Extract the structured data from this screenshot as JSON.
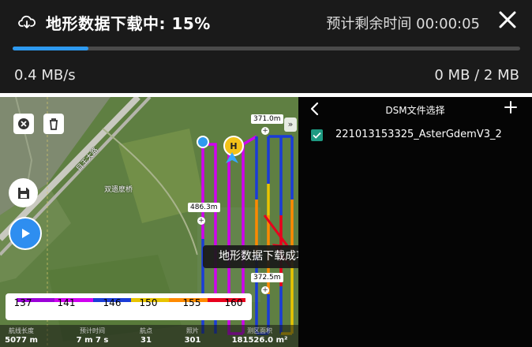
{
  "download": {
    "title": "地形数据下载中: 15%",
    "progress": 0.15,
    "remaining": "预计剩余时间 00:00:05",
    "speed": "0.4 MB/s",
    "size": "0 MB / 2 MB"
  },
  "map": {
    "labels": [
      "双遗麽桥",
      "目王大路"
    ],
    "distance_labels": [
      "371.0m",
      "486.3m",
      "372.5m"
    ],
    "home_marker": "H",
    "toast": "地形数据下载成功",
    "legend": {
      "values": [
        "137",
        "141",
        "146",
        "150",
        "155",
        "160"
      ],
      "colors": [
        "#9b00d8",
        "#d000f0",
        "#1a3cd8",
        "#e8c400",
        "#ff8a00",
        "#e8001c"
      ]
    },
    "stats": [
      {
        "label": "航线长度",
        "value": "5077 m"
      },
      {
        "label": "预计时间",
        "value": "7 m 7 s"
      },
      {
        "label": "航点",
        "value": "31"
      },
      {
        "label": "照片",
        "value": "301"
      },
      {
        "label": "测区面积",
        "value": "181526.0 m²"
      }
    ]
  },
  "dsm_panel": {
    "title": "DSM文件选择",
    "file_name": "221013153325_AsterGdemV3_2",
    "checked": true
  }
}
